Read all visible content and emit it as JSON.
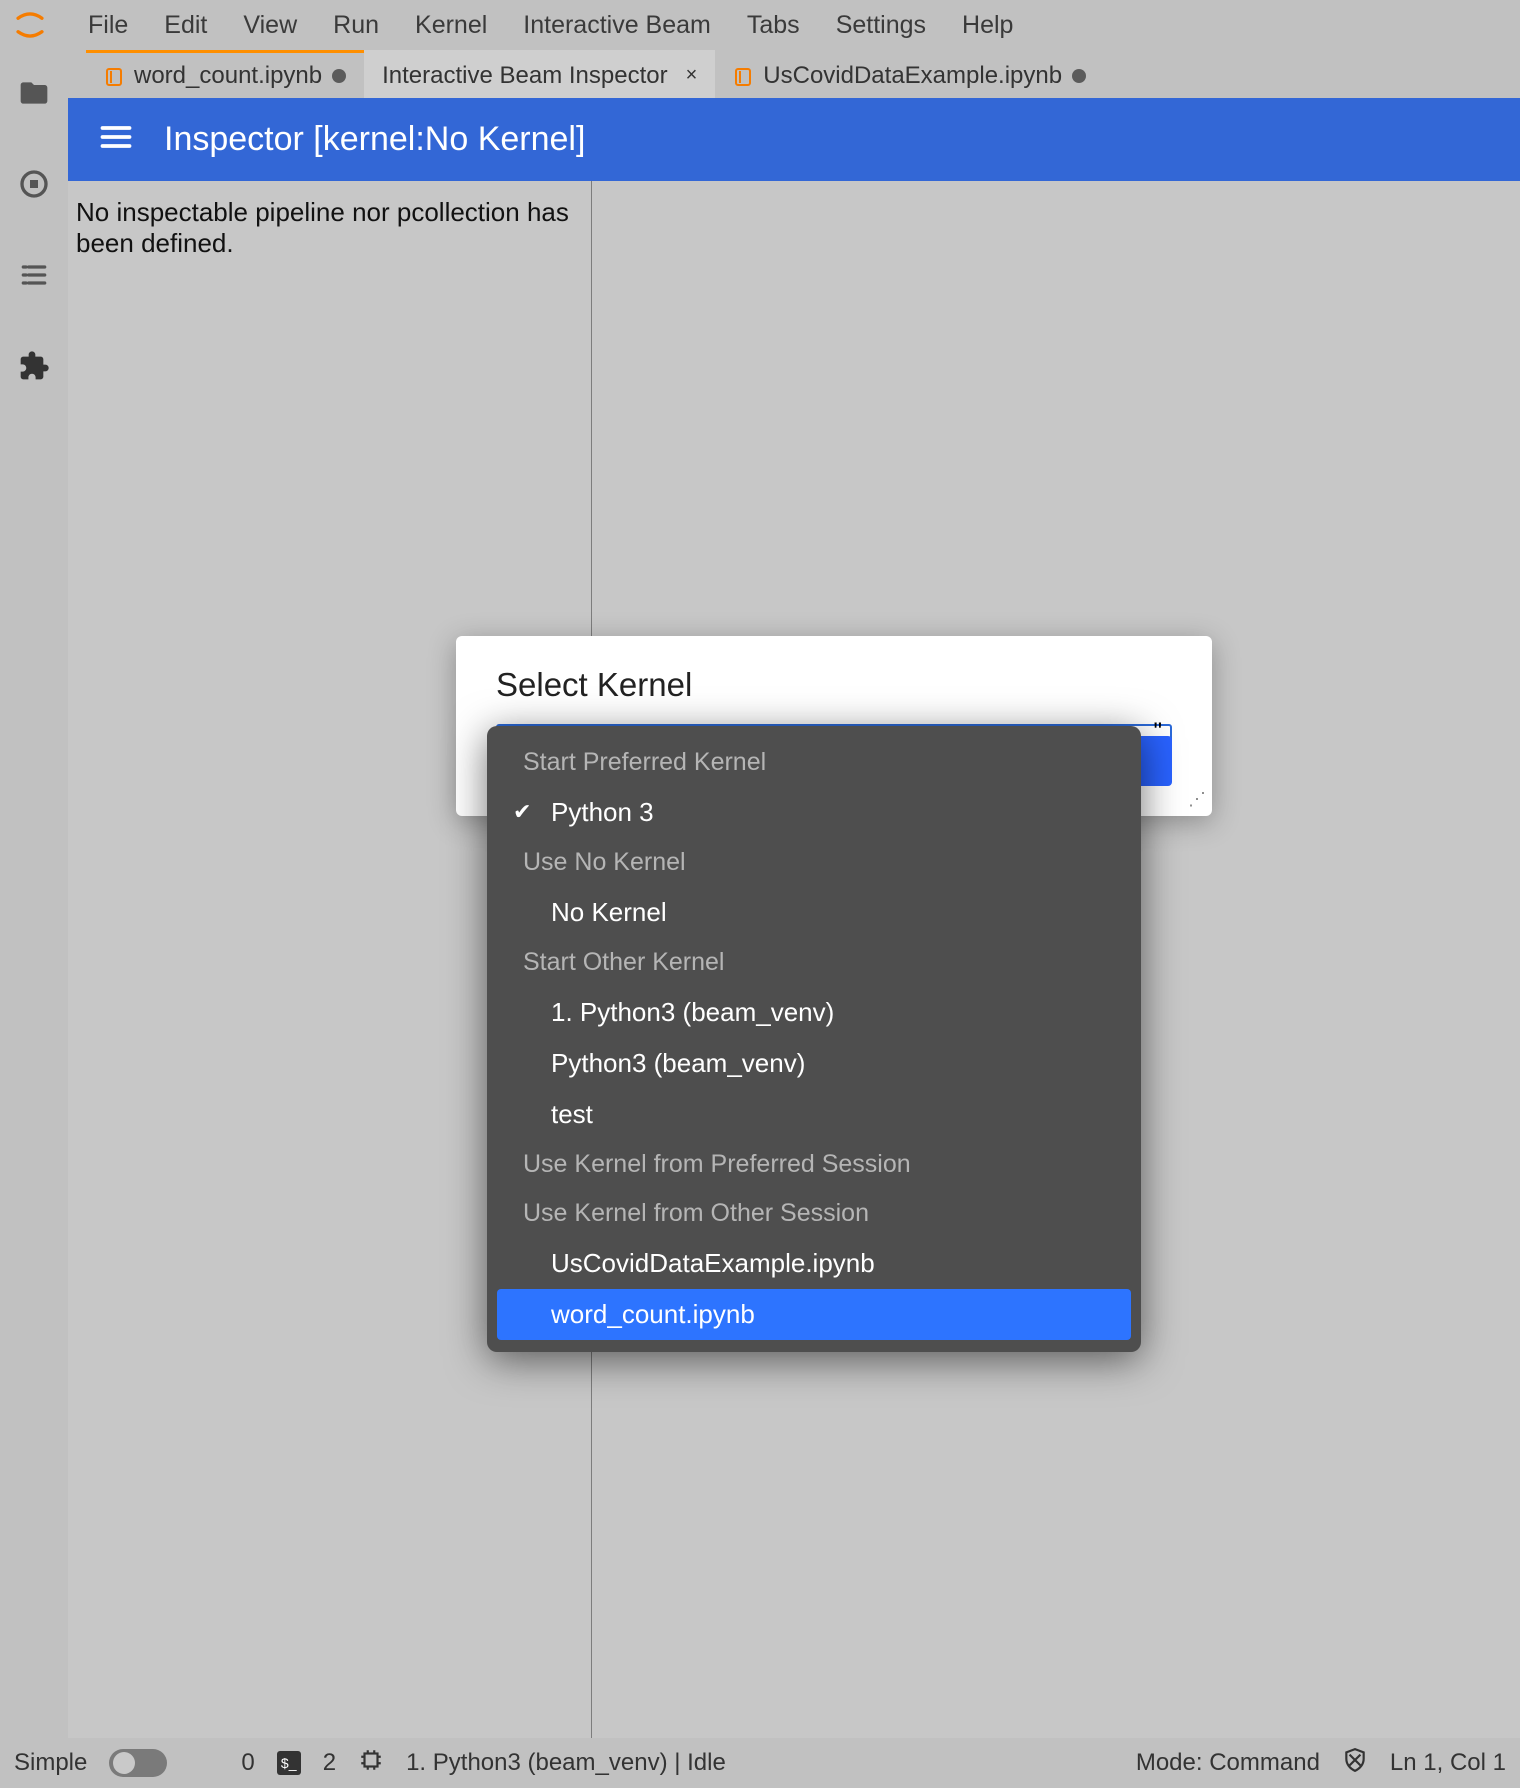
{
  "menu": {
    "items": [
      "File",
      "Edit",
      "View",
      "Run",
      "Kernel",
      "Interactive Beam",
      "Tabs",
      "Settings",
      "Help"
    ]
  },
  "tabs": [
    {
      "label": "word_count.ipynb",
      "dirty": true,
      "has_icon": true
    },
    {
      "label": "Interactive Beam Inspector",
      "closable": true
    },
    {
      "label": "UsCovidDataExample.ipynb",
      "dirty": true,
      "has_icon": true
    }
  ],
  "inspector": {
    "title": "Inspector [kernel:No Kernel]",
    "empty_message": "No inspectable pipeline nor pcollection has been defined."
  },
  "dialog": {
    "title": "Select Kernel",
    "hint_suffix": "\""
  },
  "kernel_picker": {
    "groups": [
      {
        "label": "Start Preferred Kernel",
        "options": [
          {
            "label": "Python 3",
            "checked": true
          }
        ]
      },
      {
        "label": "Use No Kernel",
        "options": [
          {
            "label": "No Kernel"
          }
        ]
      },
      {
        "label": "Start Other Kernel",
        "options": [
          {
            "label": "1. Python3 (beam_venv)"
          },
          {
            "label": "Python3 (beam_venv)"
          },
          {
            "label": "test"
          }
        ]
      },
      {
        "label": "Use Kernel from Preferred Session",
        "options": []
      },
      {
        "label": "Use Kernel from Other Session",
        "options": [
          {
            "label": "UsCovidDataExample.ipynb"
          },
          {
            "label": "word_count.ipynb",
            "selected": true
          }
        ]
      }
    ]
  },
  "statusbar": {
    "simple": "Simple",
    "count0": "0",
    "count2": "2",
    "kernel": "1. Python3 (beam_venv) | Idle",
    "mode": "Mode: Command",
    "pos": "Ln 1, Col 1"
  }
}
